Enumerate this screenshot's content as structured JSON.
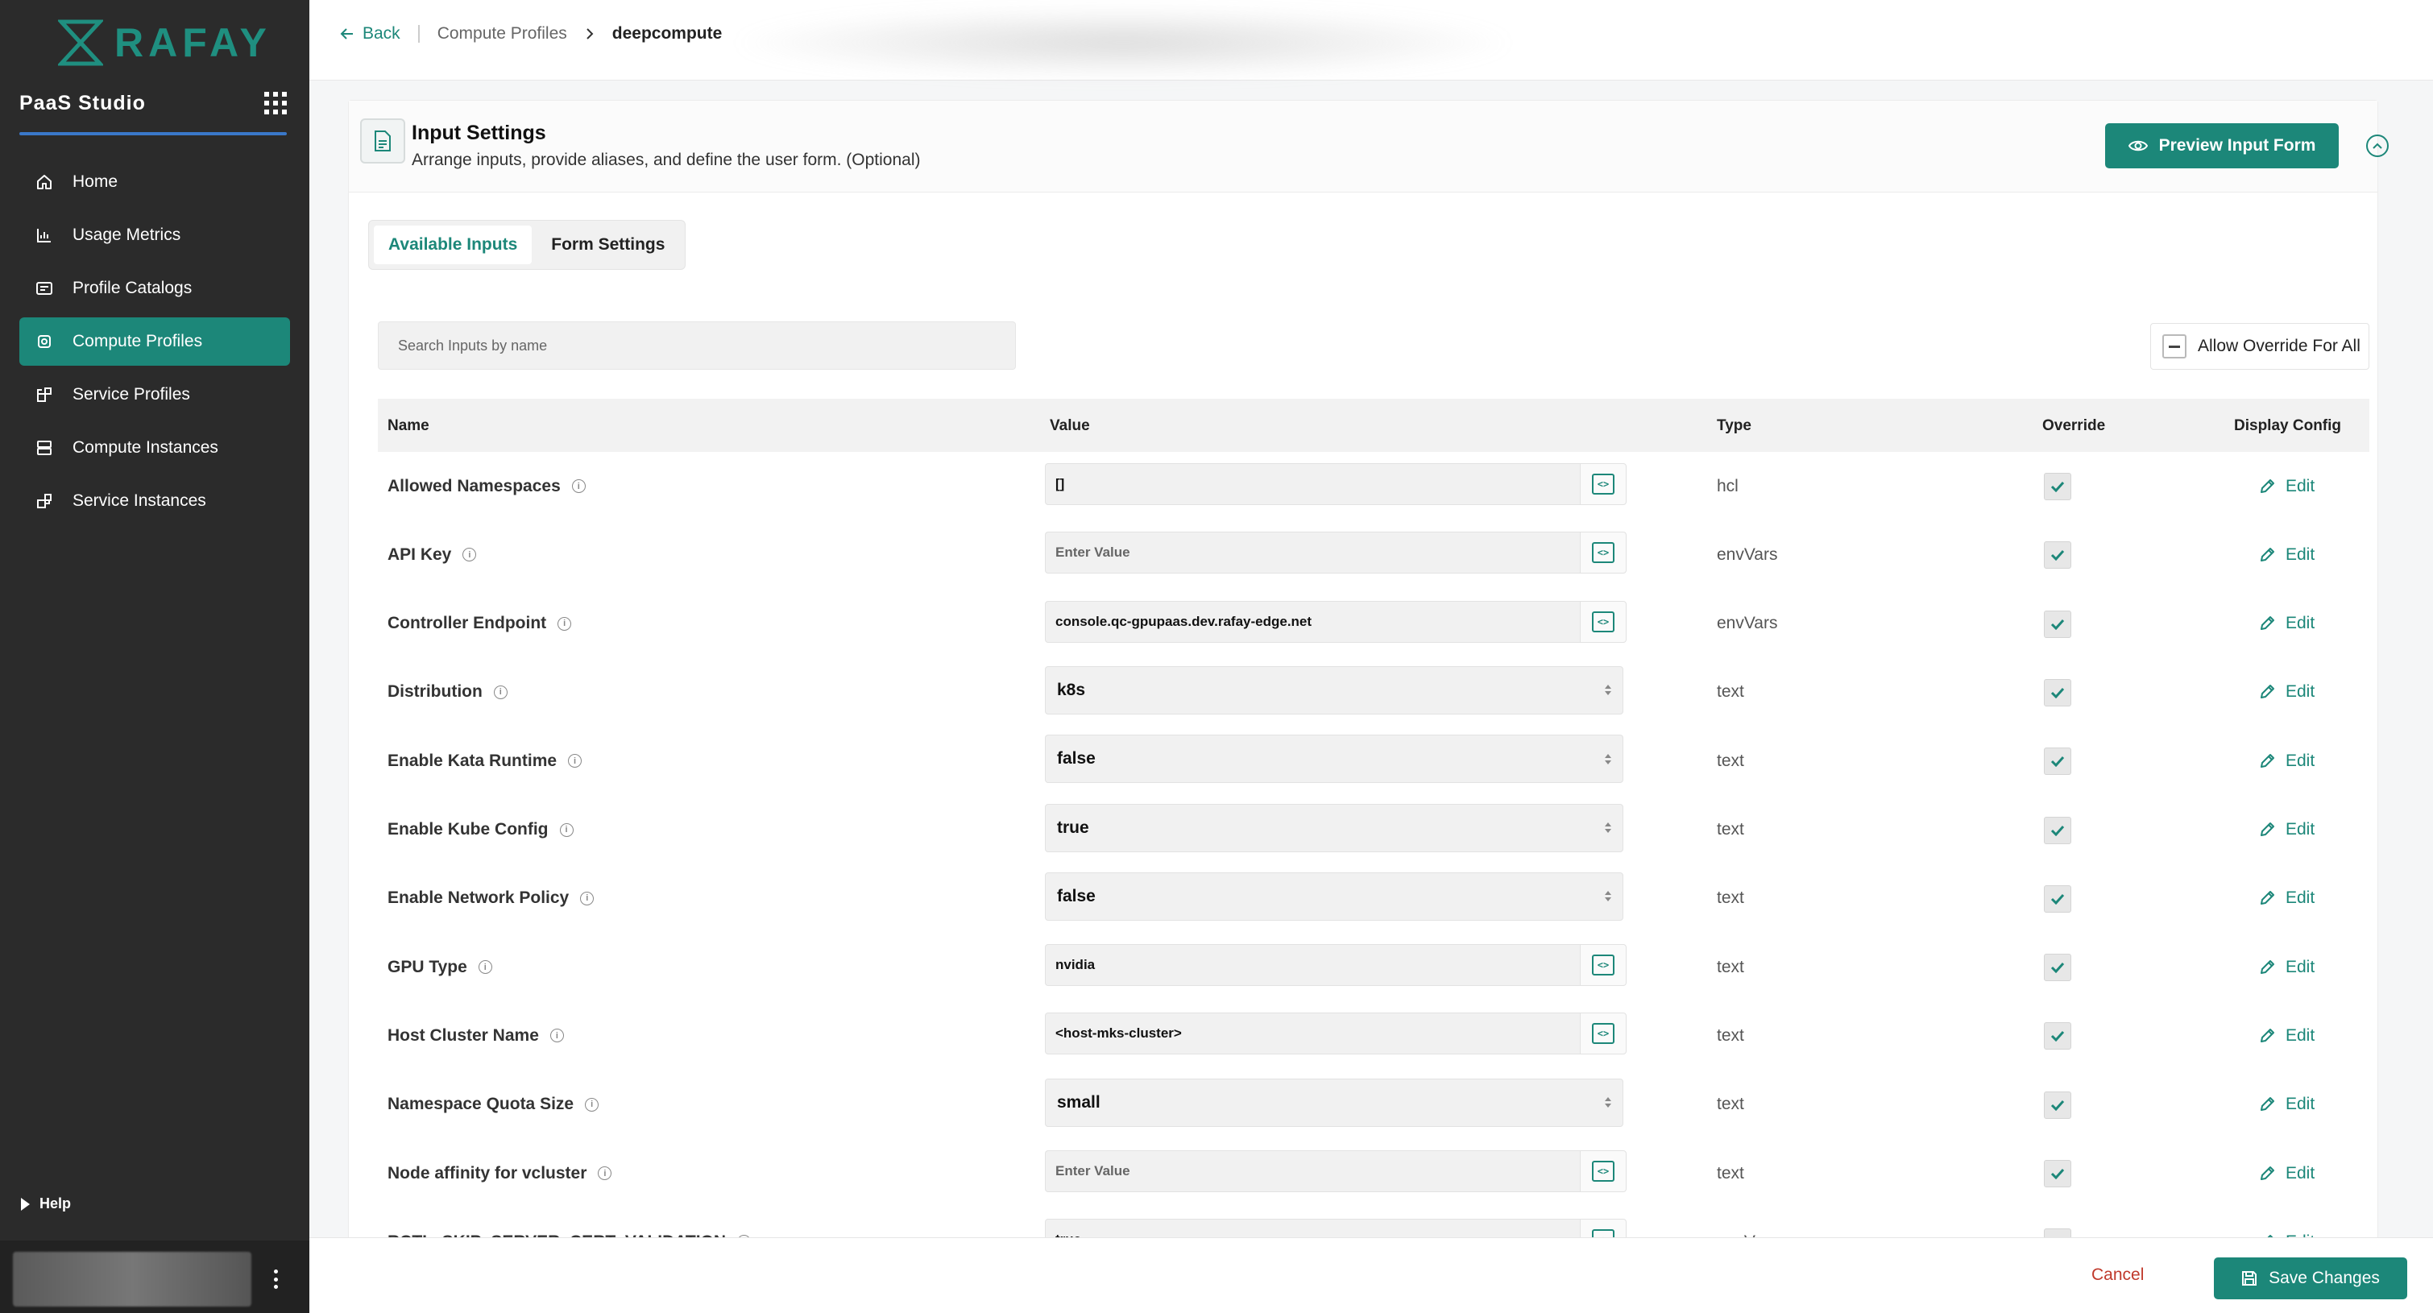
{
  "sidebar": {
    "logo_text": "RAFAY",
    "studio_title": "PaaS Studio",
    "items": [
      {
        "label": "Home",
        "icon": "home-icon"
      },
      {
        "label": "Usage Metrics",
        "icon": "chart-icon"
      },
      {
        "label": "Profile Catalogs",
        "icon": "catalog-icon"
      },
      {
        "label": "Compute Profiles",
        "icon": "compute-icon",
        "active": true
      },
      {
        "label": "Service Profiles",
        "icon": "service-icon"
      },
      {
        "label": "Compute Instances",
        "icon": "server-icon"
      },
      {
        "label": "Service Instances",
        "icon": "service-instance-icon"
      }
    ],
    "help_label": "Help"
  },
  "breadcrumb": {
    "back": "Back",
    "parent": "Compute Profiles",
    "current": "deepcompute"
  },
  "panel": {
    "title": "Input Settings",
    "subtitle": "Arrange inputs, provide aliases, and define the user form. (Optional)",
    "preview_button": "Preview Input Form"
  },
  "tabs": [
    "Available Inputs",
    "Form Settings"
  ],
  "search": {
    "placeholder": "Search Inputs by name"
  },
  "override_all_label": "Allow Override For All",
  "table": {
    "headers": {
      "name": "Name",
      "value": "Value",
      "type": "Type",
      "override": "Override",
      "display": "Display Config"
    },
    "edit_label": "Edit",
    "rows": [
      {
        "name": "Allowed Namespaces",
        "kind": "input",
        "value": "[]",
        "placeholder": "",
        "type": "hcl",
        "override": true
      },
      {
        "name": "API Key",
        "kind": "input",
        "value": "",
        "placeholder": "Enter Value",
        "type": "envVars",
        "override": true
      },
      {
        "name": "Controller Endpoint",
        "kind": "input",
        "value": "console.qc-gpupaas.dev.rafay-edge.net",
        "placeholder": "",
        "type": "envVars",
        "override": true
      },
      {
        "name": "Distribution",
        "kind": "select",
        "value": "k8s",
        "type": "text",
        "override": true
      },
      {
        "name": "Enable Kata Runtime",
        "kind": "select",
        "value": "false",
        "type": "text",
        "override": true
      },
      {
        "name": "Enable Kube Config",
        "kind": "select",
        "value": "true",
        "type": "text",
        "override": true
      },
      {
        "name": "Enable Network Policy",
        "kind": "select",
        "value": "false",
        "type": "text",
        "override": true
      },
      {
        "name": "GPU Type",
        "kind": "input",
        "value": "nvidia",
        "placeholder": "",
        "type": "text",
        "override": true
      },
      {
        "name": "Host Cluster Name",
        "kind": "input",
        "value": "<host-mks-cluster>",
        "placeholder": "",
        "type": "text",
        "override": true
      },
      {
        "name": "Namespace Quota Size",
        "kind": "select",
        "value": "small",
        "type": "text",
        "override": true
      },
      {
        "name": "Node affinity for vcluster",
        "kind": "input",
        "value": "",
        "placeholder": "Enter Value",
        "type": "text",
        "override": true
      },
      {
        "name": "RCTL_SKIP_SERVER_CERT_VALIDATION",
        "kind": "input",
        "value": "true",
        "placeholder": "",
        "type": "envVars",
        "override": false
      }
    ]
  },
  "footer": {
    "cancel": "Cancel",
    "save": "Save Changes"
  },
  "colors": {
    "accent": "#1c8779",
    "sidebar_bg": "#2b2b2b",
    "cancel": "#c0392b"
  }
}
